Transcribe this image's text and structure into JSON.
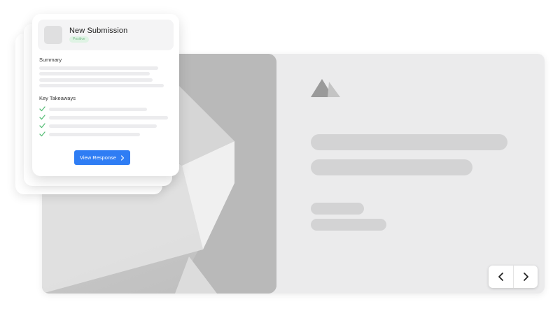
{
  "card": {
    "title": "New Submission",
    "badge": "Positive",
    "summary_label": "Summary",
    "takeaways_label": "Key Takeaways",
    "button_label": "View Response"
  },
  "icons": {
    "logo": "mountain-logo-icon",
    "check": "check-icon",
    "prev": "chevron-left-icon",
    "next": "chevron-right-icon",
    "button_arrow": "chevron-right-icon"
  },
  "colors": {
    "accent": "#2f7df4",
    "badge_bg": "#dff3e4",
    "check": "#5bbf7a"
  }
}
